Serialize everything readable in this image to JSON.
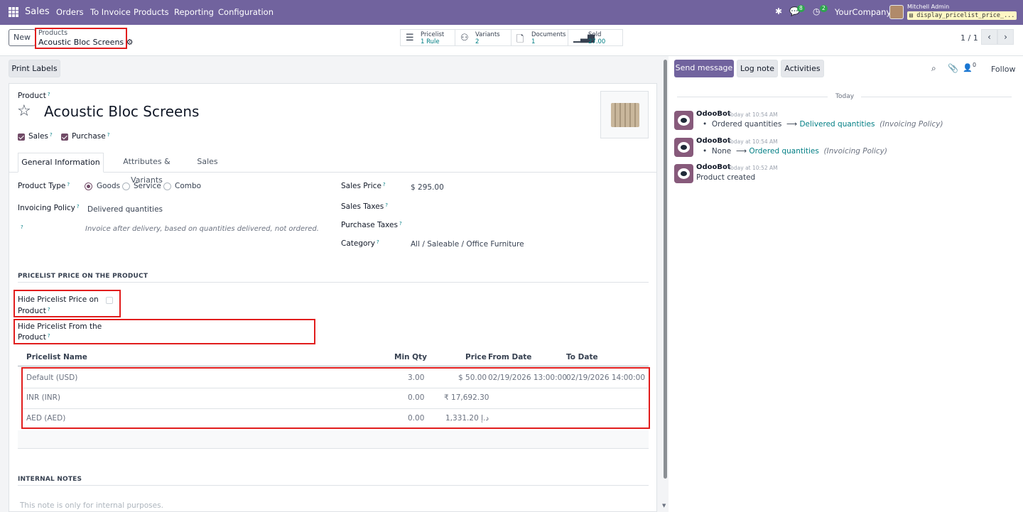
{
  "navbar": {
    "app_name": "Sales",
    "menu": [
      "Orders",
      "To Invoice",
      "Products",
      "Reporting",
      "Configuration"
    ],
    "messages_badge": "8",
    "activities_badge": "2",
    "company": "YourCompany",
    "user": "Mitchell Admin",
    "database": "display_pricelist_price_..."
  },
  "control_panel": {
    "new_label": "New",
    "breadcrumb_parent": "Products",
    "breadcrumb_current": "Acoustic Bloc Screens",
    "smart_buttons": [
      {
        "label": "Pricelist",
        "value": "1 Rule",
        "icon": "list-icon"
      },
      {
        "label": "Variants",
        "value": "2",
        "icon": "sitemap-icon"
      },
      {
        "label": "Documents",
        "value": "1",
        "icon": "file-icon"
      },
      {
        "label": "Sold",
        "value": "27.00",
        "icon": "bar-chart-icon"
      }
    ],
    "pager": "1 / 1"
  },
  "form": {
    "print_labels": "Print Labels",
    "product_label": "Product",
    "product_name": "Acoustic Bloc Screens",
    "sales_label": "Sales",
    "purchase_label": "Purchase",
    "tabs": [
      "General Information",
      "Attributes & Variants",
      "Sales"
    ],
    "product_type_label": "Product Type",
    "product_type_options": [
      "Goods",
      "Service",
      "Combo"
    ],
    "product_type_selected": "Goods",
    "invoicing_policy_label": "Invoicing Policy",
    "invoicing_policy_value": "Delivered quantities",
    "invoicing_help_qm": "?",
    "invoicing_help": "Invoice after delivery, based on quantities delivered, not ordered.",
    "sales_price_label": "Sales Price",
    "sales_price_value": "$ 295.00",
    "sales_taxes_label": "Sales Taxes",
    "purchase_taxes_label": "Purchase Taxes",
    "category_label": "Category",
    "category_value": "All / Saleable / Office Furniture",
    "pricelist_section": "PRICELIST PRICE ON THE PRODUCT",
    "hide_pricelist_price_label_1": "Hide Pricelist Price on",
    "hide_pricelist_price_label_2": "Product",
    "hide_pricelist_from_label_1": "Hide Pricelist From the",
    "hide_pricelist_from_label_2": "Product",
    "table_headers": [
      "Pricelist Name",
      "Min Qty",
      "Price",
      "From Date",
      "To Date"
    ],
    "table_rows": [
      {
        "name": "Default (USD)",
        "min_qty": "3.00",
        "price": "$ 50.00",
        "from": "02/19/2026 13:00:00",
        "to": "02/19/2026 14:00:00"
      },
      {
        "name": "INR (INR)",
        "min_qty": "0.00",
        "price": "₹ 17,692.30",
        "from": "",
        "to": ""
      },
      {
        "name": "AED (AED)",
        "min_qty": "0.00",
        "price": "1,331.20 د.إ",
        "from": "",
        "to": ""
      }
    ],
    "internal_notes_section": "INTERNAL NOTES",
    "notes_placeholder": "This note is only for internal purposes."
  },
  "chatter": {
    "send_message": "Send message",
    "log_note": "Log note",
    "activities": "Activities",
    "followers_count": "0",
    "follow": "Follow",
    "day_separator": "Today",
    "messages": [
      {
        "author": "OdooBot",
        "date": "Today at 10:54 AM",
        "old": "Ordered quantities",
        "new": "Delivered quantities",
        "field": "(Invoicing Policy)"
      },
      {
        "author": "OdooBot",
        "date": "Today at 10:54 AM",
        "old": "None",
        "new": "Ordered quantities",
        "field": "(Invoicing Policy)"
      },
      {
        "author": "OdooBot",
        "date": "Today at 10:52 AM",
        "body": "Product created"
      }
    ]
  },
  "colors": {
    "navbar": "#71639e",
    "link": "#017e84",
    "checkbox": "#714b67",
    "annotation": "#e11d1d"
  }
}
